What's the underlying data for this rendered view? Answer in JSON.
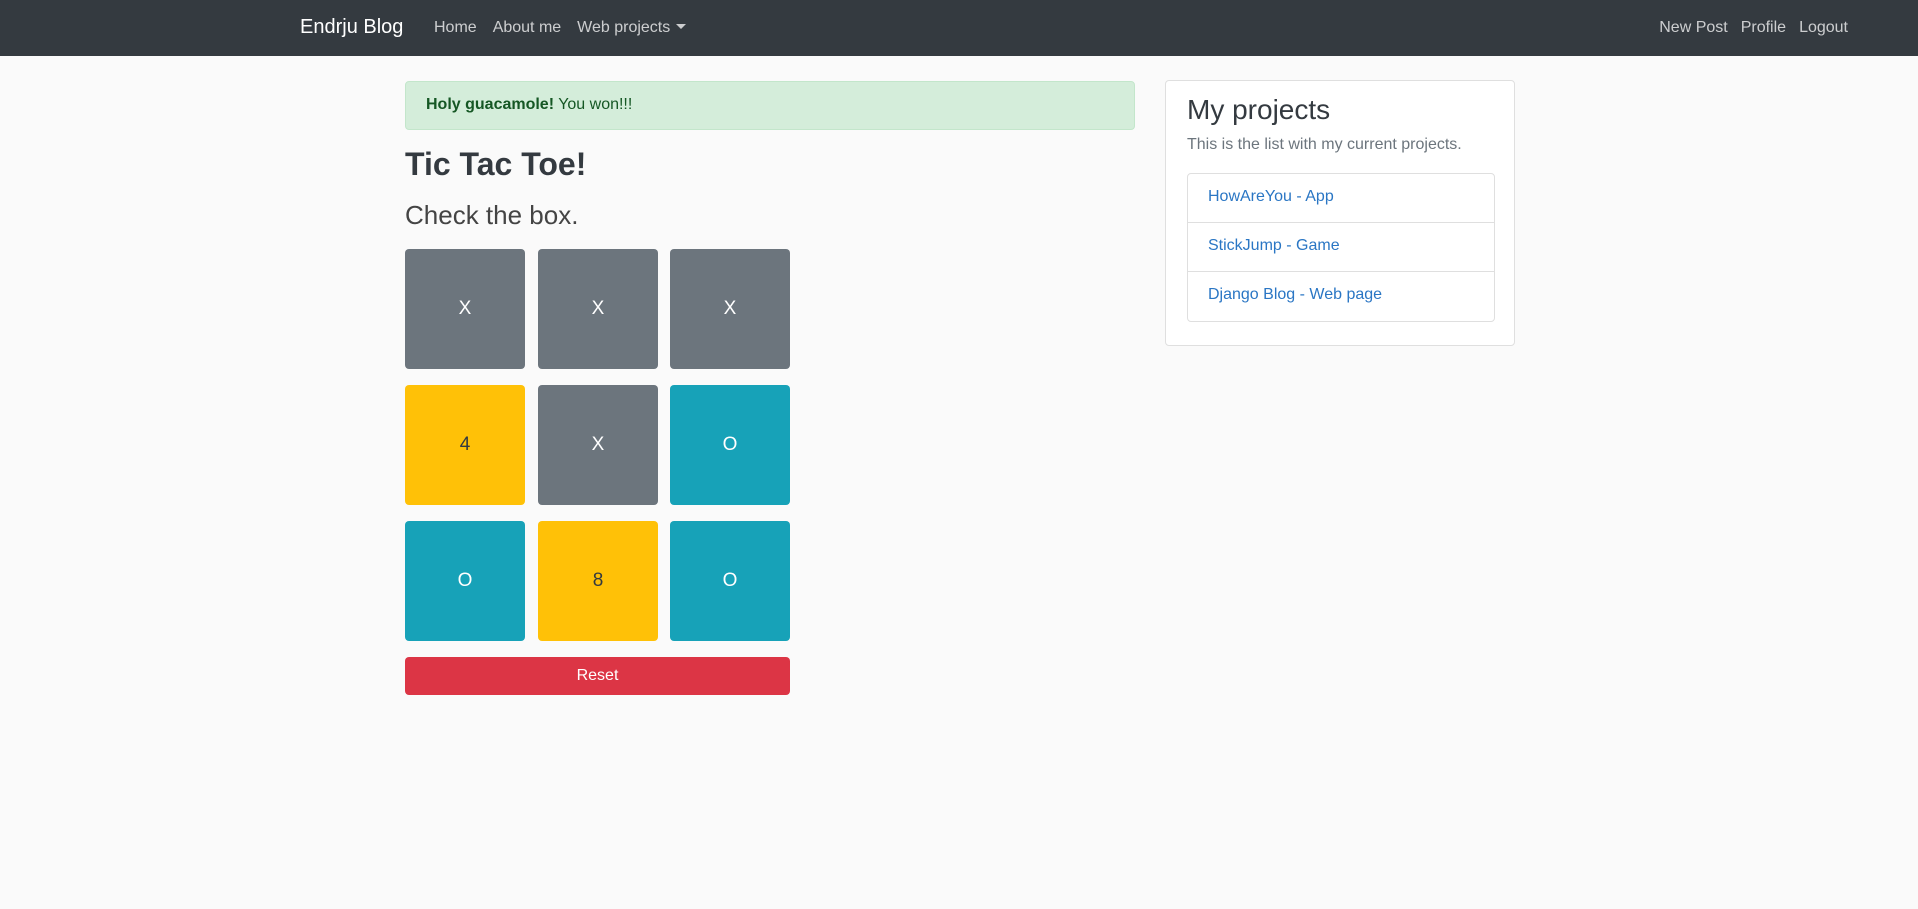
{
  "navbar": {
    "brand": "Endrju Blog",
    "left_links": [
      "Home",
      "About me",
      "Web projects"
    ],
    "right_links": [
      "New Post",
      "Profile",
      "Logout"
    ]
  },
  "alert": {
    "strong": "Holy guacamole!",
    "text": "You won!!!",
    "color": "#d4edda"
  },
  "game": {
    "title": "Tic Tac Toe!",
    "subtitle": "Check the box.",
    "cells": [
      "X",
      "X",
      "X",
      "4",
      "X",
      "O",
      "O",
      "8",
      "O"
    ],
    "reset_label": "Reset",
    "colors": {
      "x": "#6c757d",
      "o": "#17a2b8",
      "empty": "#ffc107",
      "reset": "#dc3545"
    }
  },
  "sidebar": {
    "title": "My projects",
    "text": "This is the list with my current projects.",
    "items": [
      "HowAreYou - App",
      "StickJump - Game",
      "Django Blog - Web page"
    ]
  }
}
